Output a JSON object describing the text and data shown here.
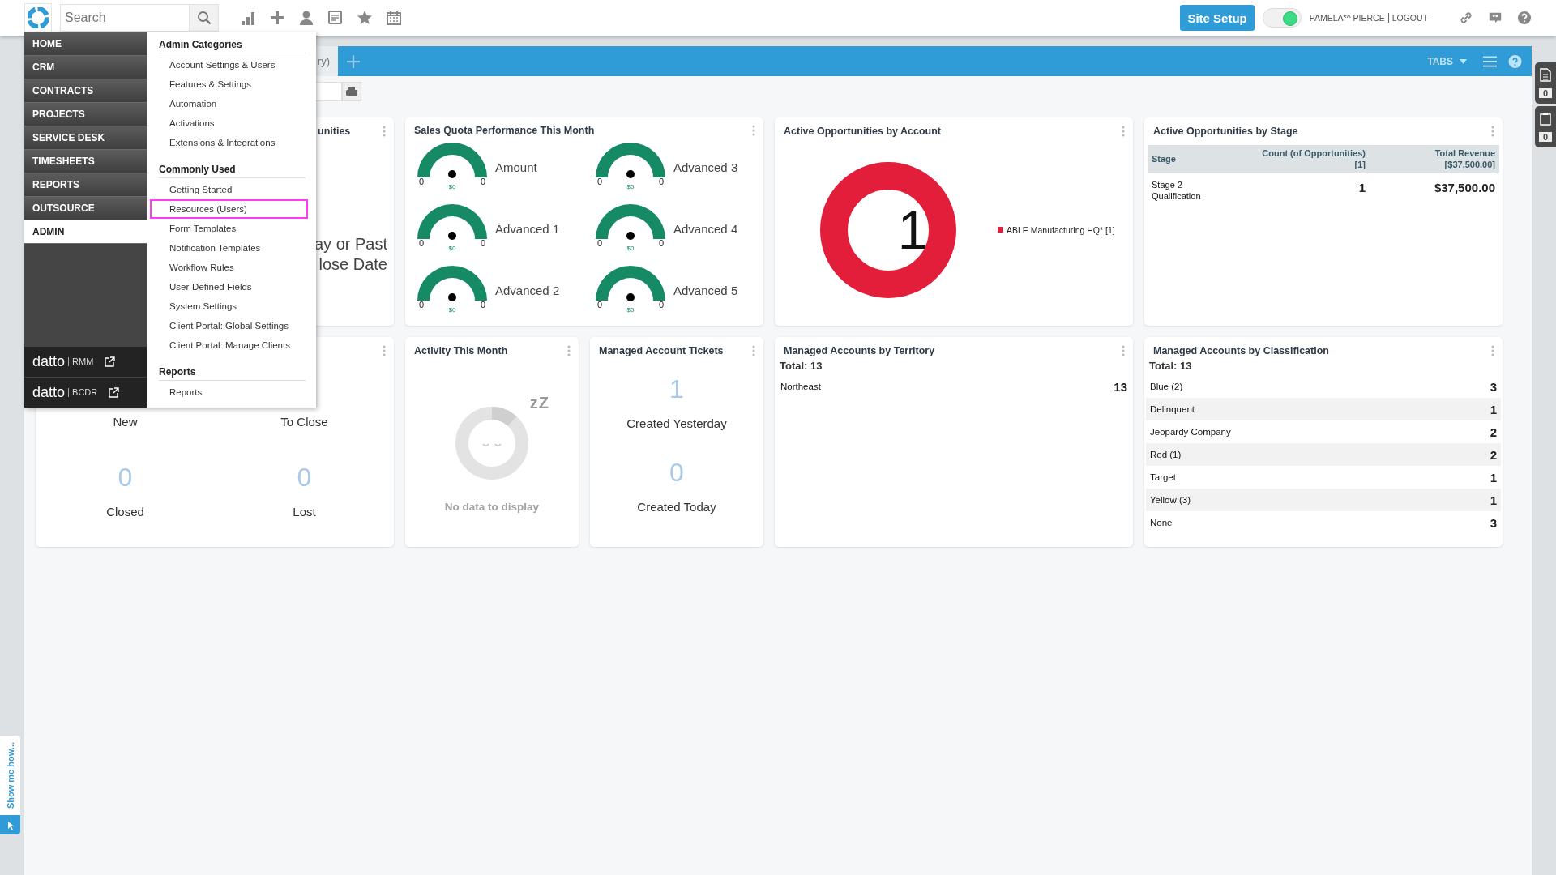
{
  "topbar": {
    "search_placeholder": "Search",
    "site_setup": "Site Setup",
    "toggle_on": true,
    "user": "PAMELA*^ PIERCE",
    "logout": "LOGOUT"
  },
  "tabbar": {
    "tabs": [
      {
        "label": "ry)",
        "selected": true
      }
    ],
    "tabs_menu": "TABS"
  },
  "right_widgets": [
    {
      "kind": "document",
      "count": "0"
    },
    {
      "kind": "clipboard",
      "count": "0"
    }
  ],
  "show_me": "Show me how...",
  "nav": {
    "items": [
      {
        "label": "HOME",
        "selected": false
      },
      {
        "label": "CRM",
        "selected": false
      },
      {
        "label": "CONTRACTS",
        "selected": false
      },
      {
        "label": "PROJECTS",
        "selected": false
      },
      {
        "label": "SERVICE DESK",
        "selected": false
      },
      {
        "label": "TIMESHEETS",
        "selected": false
      },
      {
        "label": "REPORTS",
        "selected": false
      },
      {
        "label": "OUTSOURCE",
        "selected": false
      },
      {
        "label": "ADMIN",
        "selected": true
      }
    ],
    "links": [
      {
        "brand": "datto",
        "product": "RMM"
      },
      {
        "brand": "datto",
        "product": "BCDR"
      }
    ]
  },
  "admin_menu": {
    "sections": [
      {
        "title": "Admin Categories",
        "items": [
          {
            "label": "Account Settings & Users",
            "highlighted": false
          },
          {
            "label": "Features & Settings",
            "highlighted": false
          },
          {
            "label": "Automation",
            "highlighted": false
          },
          {
            "label": "Activations",
            "highlighted": false
          },
          {
            "label": "Extensions & Integrations",
            "highlighted": false
          }
        ]
      },
      {
        "title": "Commonly Used",
        "items": [
          {
            "label": "Getting Started",
            "highlighted": false
          },
          {
            "label": "Resources (Users)",
            "highlighted": true
          },
          {
            "label": "Form Templates",
            "highlighted": false
          },
          {
            "label": "Notification Templates",
            "highlighted": false
          },
          {
            "label": "Workflow Rules",
            "highlighted": false
          },
          {
            "label": "User-Defined Fields",
            "highlighted": false
          },
          {
            "label": "System Settings",
            "highlighted": false
          },
          {
            "label": "Client Portal: Global Settings",
            "highlighted": false
          },
          {
            "label": "Client Portal: Manage Clients",
            "highlighted": false
          }
        ]
      },
      {
        "title": "Reports",
        "items": [
          {
            "label": "Reports",
            "highlighted": false
          }
        ]
      }
    ]
  },
  "card_rows": [
    [
      {
        "kind": "partial",
        "title": "unities",
        "lines": [
          "ay or Past",
          "lose Date"
        ]
      },
      {
        "kind": "gauges",
        "title": "Sales Quota Performance This Month",
        "gauges": [
          {
            "label": "Amount",
            "min": "0",
            "max": "0",
            "value": "$0"
          },
          {
            "label": "Advanced 3",
            "min": "0",
            "max": "0",
            "value": "$0"
          },
          {
            "label": "Advanced 1",
            "min": "0",
            "max": "0",
            "value": "$0"
          },
          {
            "label": "Advanced 4",
            "min": "0",
            "max": "0",
            "value": "$0"
          },
          {
            "label": "Advanced 2",
            "min": "0",
            "max": "0",
            "value": "$0"
          },
          {
            "label": "Advanced 5",
            "min": "0",
            "max": "0",
            "value": "$0"
          }
        ]
      },
      {
        "kind": "donut",
        "title": "Active Opportunities by Account",
        "center": "1",
        "legend": [
          {
            "label": "ABLE Manufacturing HQ* [1]",
            "color": "#e31e3a"
          }
        ]
      },
      {
        "kind": "table",
        "title": "Active Opportunities by Stage",
        "columns": [
          {
            "title": "Stage"
          },
          {
            "title": "Count (of Opportunities)",
            "total": "[1]"
          },
          {
            "title": "Total Revenue",
            "total": "[$37,500.00]"
          }
        ],
        "rows": [
          [
            "Stage 2 Qualification",
            "1",
            "$37,500.00"
          ]
        ]
      }
    ],
    [
      {
        "kind": "stats",
        "stats": [
          {
            "label": "New"
          },
          {
            "label": "To Close"
          },
          {
            "value": "0",
            "label": "Closed"
          },
          {
            "value": "0",
            "label": "Lost"
          }
        ]
      },
      {
        "kind": "empty",
        "title": "Activity This Month",
        "sleep_mark": "zZ",
        "message": "No data to display"
      },
      {
        "kind": "stats",
        "title": "Managed Account Tickets",
        "stats": [
          {
            "value": "1",
            "label": "Created Yesterday"
          },
          {
            "value": "0",
            "label": "Created Today"
          }
        ]
      },
      {
        "kind": "list",
        "title": "Managed Accounts by Territory",
        "total": "Total:  13",
        "rows": [
          {
            "label": "Northeast",
            "value": "13"
          }
        ]
      },
      {
        "kind": "list",
        "title": "Managed Accounts by Classification",
        "total": "Total:  13",
        "rows": [
          {
            "label": "Blue (2)",
            "value": "3"
          },
          {
            "label": "Delinquent",
            "value": "1"
          },
          {
            "label": "Jeopardy Company",
            "value": "2"
          },
          {
            "label": "Red (1)",
            "value": "2"
          },
          {
            "label": "Target",
            "value": "1"
          },
          {
            "label": "Yellow (3)",
            "value": "1"
          },
          {
            "label": "None",
            "value": "3"
          }
        ]
      }
    ]
  ]
}
